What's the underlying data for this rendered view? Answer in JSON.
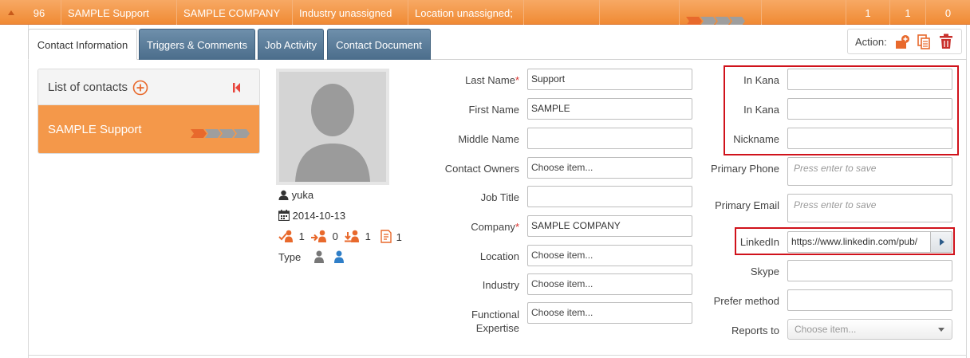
{
  "top_row": {
    "id": "96",
    "name": "SAMPLE Support",
    "company": "SAMPLE COMPANY",
    "industry": "Industry unassigned",
    "location": "Location unassigned;",
    "count1": "1",
    "count2": "1",
    "count3": "0"
  },
  "tabs": [
    {
      "label": "Contact Information"
    },
    {
      "label": "Triggers & Comments"
    },
    {
      "label": "Job Activity"
    },
    {
      "label": "Contact Document"
    }
  ],
  "action": {
    "label": "Action:",
    "icons": [
      "add-contact-icon",
      "copy-icon",
      "delete-icon"
    ],
    "colors": {
      "orange": "#e8692c",
      "red": "#c9302c"
    }
  },
  "contacts": {
    "title": "List of contacts",
    "items": [
      {
        "name": "SAMPLE Support"
      }
    ]
  },
  "profile": {
    "owner": "yuka",
    "date": "2014-10-13",
    "stats": [
      {
        "icon": "trigger-check-icon",
        "value": "1"
      },
      {
        "icon": "trigger-forward-icon",
        "value": "0"
      },
      {
        "icon": "trigger-down-icon",
        "value": "1"
      },
      {
        "icon": "document-icon",
        "value": "1"
      }
    ],
    "type_label": "Type"
  },
  "form": {
    "last_name": {
      "label": "Last Name",
      "value": "Support"
    },
    "first_name": {
      "label": "First Name",
      "value": "SAMPLE"
    },
    "middle_name": {
      "label": "Middle Name",
      "value": ""
    },
    "contact_owners": {
      "label": "Contact Owners",
      "value": "Choose item..."
    },
    "job_title": {
      "label": "Job Title",
      "value": ""
    },
    "company": {
      "label": "Company",
      "value": "SAMPLE COMPANY"
    },
    "location": {
      "label": "Location",
      "value": "Choose item..."
    },
    "industry": {
      "label": "Industry",
      "value": "Choose item..."
    },
    "functional_expertise": {
      "label_line1": "Functional",
      "label_line2": "Expertise",
      "value": "Choose item..."
    },
    "in_kana_1": {
      "label": "In Kana",
      "value": ""
    },
    "in_kana_2": {
      "label": "In Kana",
      "value": ""
    },
    "nickname": {
      "label": "Nickname",
      "value": ""
    },
    "primary_phone": {
      "label": "Primary Phone",
      "placeholder": "Press enter to save"
    },
    "primary_email": {
      "label": "Primary Email",
      "placeholder": "Press enter to save"
    },
    "linkedin": {
      "label": "LinkedIn",
      "value": "https://www.linkedin.com/pub/"
    },
    "skype": {
      "label": "Skype",
      "value": ""
    },
    "prefer_method": {
      "label": "Prefer method",
      "value": ""
    },
    "reports_to": {
      "label": "Reports to",
      "value": "Choose item..."
    }
  },
  "colors": {
    "accent_orange": "#f08a34",
    "tab_blue": "#4b6d8b",
    "highlight_red": "#d0121b"
  }
}
